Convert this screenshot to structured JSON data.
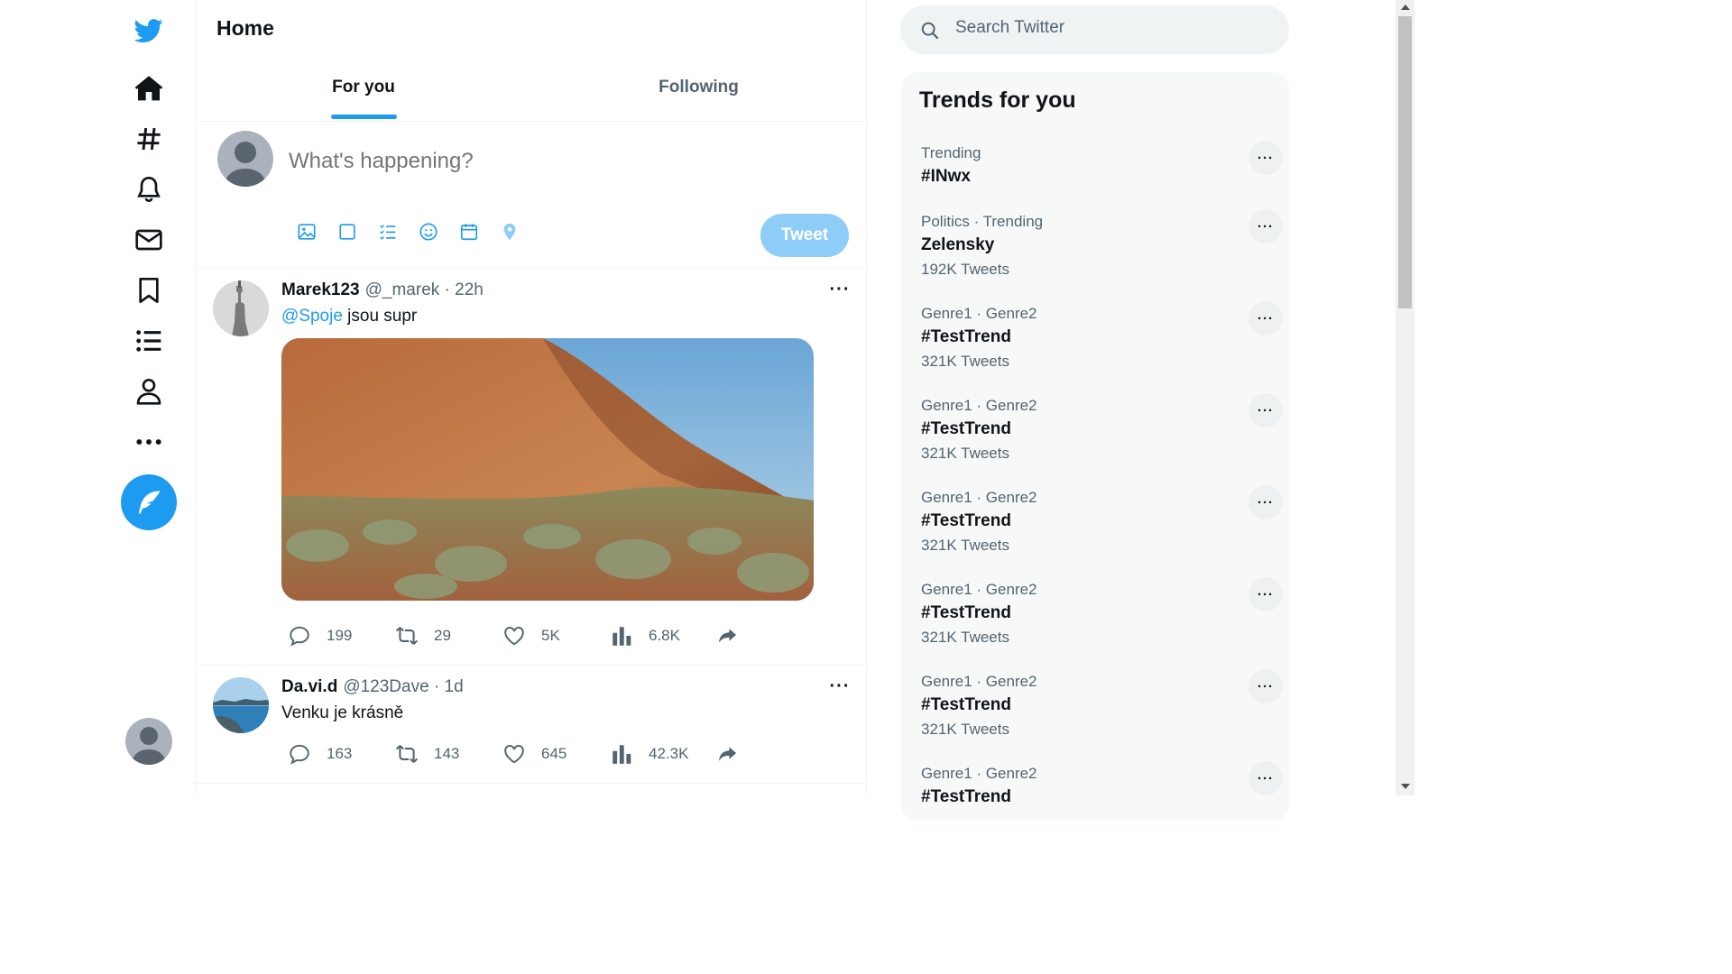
{
  "app": {
    "name": "Twitter",
    "brand_color": "#1d9bf0"
  },
  "nav": {
    "items": [
      {
        "icon": "twitter-logo-icon"
      },
      {
        "icon": "home-icon"
      },
      {
        "icon": "hashtag-explore-icon"
      },
      {
        "icon": "bell-notifications-icon"
      },
      {
        "icon": "envelope-messages-icon"
      },
      {
        "icon": "bookmark-icon"
      },
      {
        "icon": "list-icon"
      },
      {
        "icon": "profile-icon"
      },
      {
        "icon": "more-icon"
      }
    ],
    "compose_icon": "feather-compose-icon"
  },
  "main": {
    "title": "Home",
    "tabs": [
      {
        "label": "For you",
        "active": true
      },
      {
        "label": "Following",
        "active": false
      }
    ],
    "composer": {
      "placeholder": "What's happening?",
      "button_label": "Tweet",
      "tools": [
        "image-icon",
        "gif-square-icon",
        "poll-icon",
        "emoji-icon",
        "schedule-icon",
        "location-icon"
      ]
    },
    "tweets": [
      {
        "name": "Marek123",
        "handle": "@_marek",
        "time": "· 22h",
        "mention": "@Spoje",
        "text": " jsou supr",
        "has_media": true,
        "replies": "199",
        "retweets": "29",
        "likes": "5K",
        "views": "6.8K"
      },
      {
        "name": "Da.vi.d",
        "handle": "@123Dave",
        "time": "· 1d",
        "text": "Venku je krásně",
        "replies": "163",
        "retweets": "143",
        "likes": "645",
        "views": "42.3K"
      }
    ]
  },
  "sidebar": {
    "search_placeholder": "Search Twitter",
    "trends_title": "Trends for you",
    "trends": [
      {
        "meta": "Trending",
        "name": "#INwx",
        "count": ""
      },
      {
        "meta": "Politics · Trending",
        "name": "Zelensky",
        "count": "192K Tweets"
      },
      {
        "meta": "Genre1 · Genre2",
        "name": "#TestTrend",
        "count": "321K Tweets"
      },
      {
        "meta": "Genre1 · Genre2",
        "name": "#TestTrend",
        "count": "321K Tweets"
      },
      {
        "meta": "Genre1 · Genre2",
        "name": "#TestTrend",
        "count": "321K Tweets"
      },
      {
        "meta": "Genre1 · Genre2",
        "name": "#TestTrend",
        "count": "321K Tweets"
      },
      {
        "meta": "Genre1 · Genre2",
        "name": "#TestTrend",
        "count": "321K Tweets"
      },
      {
        "meta": "Genre1 · Genre2",
        "name": "#TestTrend",
        "count": ""
      }
    ],
    "more_label": "···"
  }
}
